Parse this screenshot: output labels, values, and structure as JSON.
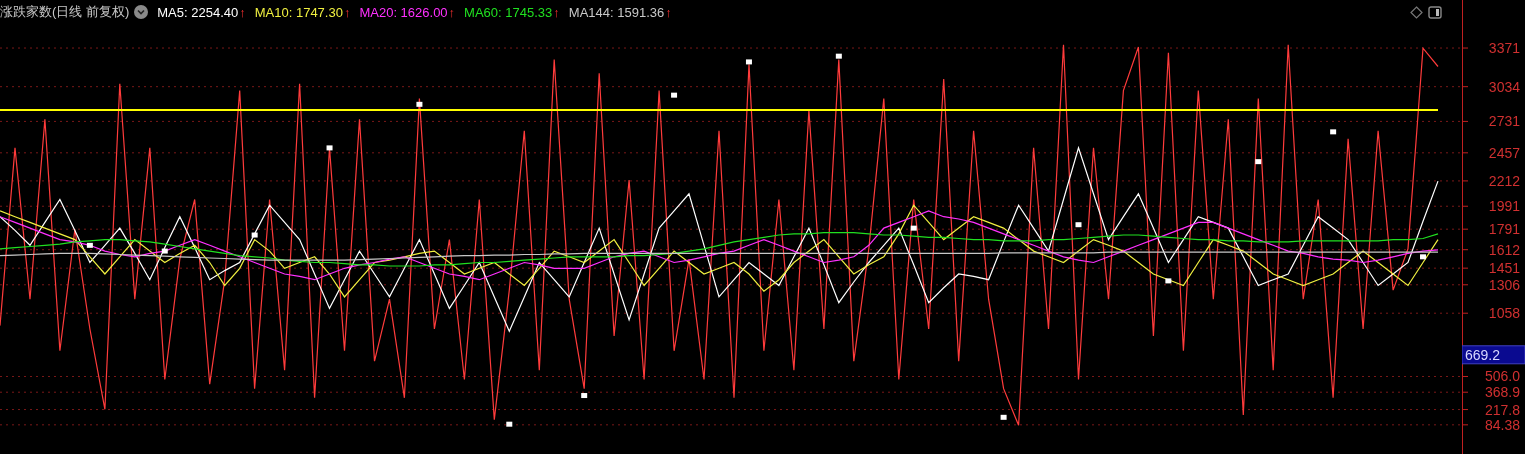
{
  "header": {
    "title": "涨跌家数(日线 前复权)",
    "indicators": [
      {
        "label": "MA5: 2254.40",
        "arrow": "↑"
      },
      {
        "label": "MA10: 1747.30",
        "arrow": "↑"
      },
      {
        "label": "MA20: 1626.00",
        "arrow": "↑"
      },
      {
        "label": "MA60: 1745.33",
        "arrow": "↑"
      },
      {
        "label": "MA144: 1591.36",
        "arrow": "↑"
      }
    ]
  },
  "axis_tag": {
    "label": "669.2"
  },
  "chart_data": {
    "type": "line",
    "ylim": [
      -170,
      3790
    ],
    "grid": true,
    "yticks": [
      {
        "value": 3371,
        "label": "3371"
      },
      {
        "value": 3034,
        "label": "3034"
      },
      {
        "value": 2731,
        "label": "2731"
      },
      {
        "value": 2457,
        "label": "2457"
      },
      {
        "value": 2212,
        "label": "2212"
      },
      {
        "value": 1991,
        "label": "1991"
      },
      {
        "value": 1791,
        "label": "1791"
      },
      {
        "value": 1612,
        "label": "1612"
      },
      {
        "value": 1451,
        "label": "1451"
      },
      {
        "value": 1306,
        "label": "1306"
      },
      {
        "value": 1058,
        "label": "1058"
      },
      {
        "value": 506,
        "label": "506.0"
      },
      {
        "value": 368.9,
        "label": "368.9"
      },
      {
        "value": 217.8,
        "label": "217.8"
      },
      {
        "value": 84.38,
        "label": "84.38"
      }
    ],
    "series": [
      {
        "color": "#ff3b3b",
        "values": [
          950,
          2500,
          1180,
          2750,
          730,
          1790,
          920,
          220,
          3060,
          1180,
          2500,
          480,
          1530,
          2050,
          440,
          1350,
          3000,
          400,
          2050,
          560,
          3060,
          320,
          2500,
          730,
          2750,
          640,
          1180,
          320,
          2930,
          920,
          1700,
          480,
          2050,
          130,
          1260,
          2650,
          560,
          3270,
          1180,
          400,
          3150,
          860,
          2220,
          480,
          3000,
          730,
          1530,
          480,
          2650,
          320,
          3230,
          730,
          2050,
          560,
          2830,
          920,
          3270,
          640,
          1620,
          2930,
          480,
          2050,
          920,
          3100,
          640,
          2650,
          1180,
          400,
          80,
          2500,
          920,
          3400,
          480,
          2500,
          1180,
          3000,
          3380,
          860,
          3330,
          730,
          3000,
          1180,
          2750,
          170,
          2930,
          560,
          3400,
          1180,
          2050,
          320,
          2580,
          920,
          2650,
          1260,
          1620,
          3370,
          3210
        ]
      },
      {
        "color": "#ffffff",
        "values": [
          1900,
          1780,
          1650,
          1850,
          2050,
          1780,
          1500,
          1650,
          1800,
          1580,
          1350,
          1630,
          1900,
          1630,
          1350,
          1430,
          1500,
          1750,
          2000,
          1850,
          1700,
          1400,
          1100,
          1350,
          1600,
          1400,
          1200,
          1450,
          1700,
          1400,
          1100,
          1300,
          1500,
          1200,
          900,
          1200,
          1500,
          1350,
          1200,
          1500,
          1800,
          1400,
          1000,
          1400,
          1800,
          1950,
          2100,
          1650,
          1200,
          1350,
          1500,
          1400,
          1300,
          1550,
          1800,
          1480,
          1150,
          1330,
          1500,
          1650,
          1800,
          1480,
          1150,
          1280,
          1400,
          1380,
          1350,
          1680,
          2000,
          1800,
          1600,
          2050,
          2500,
          2100,
          1700,
          1900,
          2100,
          1800,
          1500,
          1700,
          1900,
          1850,
          1800,
          1550,
          1300,
          1350,
          1400,
          1650,
          1900,
          1800,
          1700,
          1500,
          1300,
          1400,
          1500,
          1860,
          2210
        ]
      },
      {
        "color": "#f0f040",
        "values": [
          1950,
          1900,
          1850,
          1800,
          1750,
          1700,
          1550,
          1400,
          1550,
          1700,
          1600,
          1500,
          1580,
          1650,
          1500,
          1300,
          1450,
          1700,
          1600,
          1450,
          1500,
          1550,
          1400,
          1200,
          1350,
          1500,
          1520,
          1550,
          1580,
          1600,
          1500,
          1400,
          1450,
          1500,
          1400,
          1300,
          1450,
          1600,
          1550,
          1500,
          1600,
          1700,
          1500,
          1300,
          1450,
          1600,
          1500,
          1400,
          1450,
          1500,
          1400,
          1250,
          1350,
          1500,
          1600,
          1700,
          1550,
          1400,
          1480,
          1550,
          1750,
          2000,
          1850,
          1700,
          1800,
          1900,
          1850,
          1800,
          1700,
          1600,
          1550,
          1500,
          1600,
          1700,
          1650,
          1600,
          1500,
          1400,
          1350,
          1300,
          1500,
          1700,
          1650,
          1600,
          1500,
          1400,
          1350,
          1300,
          1350,
          1400,
          1500,
          1600,
          1500,
          1400,
          1300,
          1500,
          1700
        ]
      },
      {
        "color": "#ff30ff",
        "values": [
          1900,
          1850,
          1800,
          1750,
          1700,
          1680,
          1650,
          1600,
          1570,
          1550,
          1580,
          1600,
          1650,
          1700,
          1650,
          1600,
          1550,
          1500,
          1450,
          1400,
          1380,
          1350,
          1400,
          1450,
          1480,
          1500,
          1530,
          1550,
          1500,
          1450,
          1400,
          1380,
          1350,
          1400,
          1450,
          1500,
          1480,
          1450,
          1450,
          1450,
          1500,
          1550,
          1580,
          1600,
          1550,
          1500,
          1520,
          1550,
          1580,
          1600,
          1650,
          1700,
          1650,
          1600,
          1550,
          1500,
          1520,
          1550,
          1650,
          1800,
          1850,
          1900,
          1950,
          1900,
          1880,
          1850,
          1800,
          1750,
          1700,
          1650,
          1600,
          1550,
          1520,
          1500,
          1550,
          1600,
          1650,
          1700,
          1750,
          1800,
          1850,
          1850,
          1800,
          1750,
          1700,
          1650,
          1600,
          1580,
          1550,
          1530,
          1520,
          1500,
          1520,
          1550,
          1580,
          1600,
          1610
        ]
      },
      {
        "color": "#20e020",
        "values": [
          1620,
          1630,
          1640,
          1650,
          1660,
          1680,
          1690,
          1700,
          1700,
          1690,
          1680,
          1660,
          1640,
          1620,
          1600,
          1580,
          1560,
          1550,
          1540,
          1520,
          1510,
          1500,
          1500,
          1490,
          1480,
          1480,
          1470,
          1470,
          1470,
          1480,
          1480,
          1490,
          1500,
          1500,
          1510,
          1520,
          1530,
          1540,
          1550,
          1550,
          1550,
          1550,
          1560,
          1560,
          1570,
          1580,
          1600,
          1620,
          1650,
          1680,
          1700,
          1720,
          1740,
          1750,
          1750,
          1760,
          1760,
          1760,
          1750,
          1740,
          1740,
          1730,
          1720,
          1720,
          1710,
          1700,
          1700,
          1690,
          1690,
          1690,
          1700,
          1700,
          1710,
          1720,
          1730,
          1740,
          1740,
          1730,
          1720,
          1710,
          1700,
          1700,
          1690,
          1690,
          1680,
          1680,
          1680,
          1690,
          1690,
          1690,
          1690,
          1690,
          1690,
          1700,
          1700,
          1710,
          1750
        ]
      },
      {
        "color": "#c8c8c8",
        "values": [
          1560,
          1565,
          1570,
          1575,
          1580,
          1580,
          1580,
          1575,
          1570,
          1565,
          1560,
          1555,
          1550,
          1545,
          1540,
          1535,
          1530,
          1525,
          1520,
          1520,
          1520,
          1520,
          1520,
          1520,
          1525,
          1530,
          1535,
          1540,
          1545,
          1550,
          1555,
          1560,
          1560,
          1565,
          1565,
          1570,
          1570,
          1575,
          1575,
          1580,
          1580,
          1580,
          1580,
          1580,
          1580,
          1580,
          1580,
          1580,
          1580,
          1580,
          1580,
          1580,
          1580,
          1580,
          1580,
          1580,
          1580,
          1580,
          1580,
          1580,
          1580,
          1580,
          1580,
          1580,
          1580,
          1580,
          1580,
          1585,
          1585,
          1585,
          1585,
          1585,
          1585,
          1585,
          1590,
          1590,
          1590,
          1590,
          1590,
          1590,
          1590,
          1590,
          1590,
          1590,
          1590,
          1590,
          1590,
          1590,
          1590,
          1590,
          1590,
          1590,
          1590,
          1590,
          1590,
          1590,
          1590
        ]
      },
      {
        "color": "#ffff00",
        "values": [
          2830,
          2830,
          2830,
          2830,
          2830,
          2830,
          2830,
          2830,
          2830,
          2830,
          2830,
          2830,
          2830,
          2830,
          2830,
          2830,
          2830,
          2830,
          2830,
          2830,
          2830,
          2830,
          2830,
          2830,
          2830,
          2830,
          2830,
          2830,
          2830,
          2830,
          2830,
          2830,
          2830,
          2830,
          2830,
          2830,
          2830,
          2830,
          2830,
          2830,
          2830,
          2830,
          2830,
          2830,
          2830,
          2830,
          2830,
          2830,
          2830,
          2830,
          2830,
          2830,
          2830,
          2830,
          2830,
          2830,
          2830,
          2830,
          2830,
          2830,
          2830,
          2830,
          2830,
          2830,
          2830,
          2830,
          2830,
          2830,
          2830,
          2830,
          2830,
          2830,
          2830,
          2830,
          2830,
          2830,
          2830,
          2830,
          2830,
          2830,
          2830,
          2830,
          2830,
          2830,
          2830,
          2830,
          2830,
          2830,
          2830,
          2830,
          2830,
          2830,
          2830,
          2830,
          2830,
          2830,
          2830
        ]
      },
      {
        "type": "scatter",
        "color": "#ffffff",
        "values": [
          null,
          null,
          null,
          null,
          null,
          null,
          1650,
          null,
          null,
          null,
          null,
          1600,
          null,
          null,
          null,
          null,
          null,
          1740,
          null,
          null,
          null,
          null,
          2500,
          null,
          null,
          null,
          null,
          null,
          2880,
          null,
          null,
          null,
          null,
          null,
          90,
          null,
          null,
          null,
          null,
          340,
          null,
          null,
          null,
          null,
          null,
          2960,
          null,
          null,
          null,
          null,
          3250,
          null,
          null,
          null,
          null,
          null,
          3300,
          null,
          null,
          null,
          null,
          1800,
          null,
          null,
          null,
          null,
          null,
          150,
          null,
          null,
          null,
          null,
          1830,
          null,
          null,
          null,
          null,
          null,
          1340,
          null,
          null,
          null,
          null,
          null,
          2380,
          null,
          null,
          null,
          null,
          2640,
          null,
          null,
          null,
          null,
          null,
          1550,
          null
        ]
      }
    ]
  }
}
